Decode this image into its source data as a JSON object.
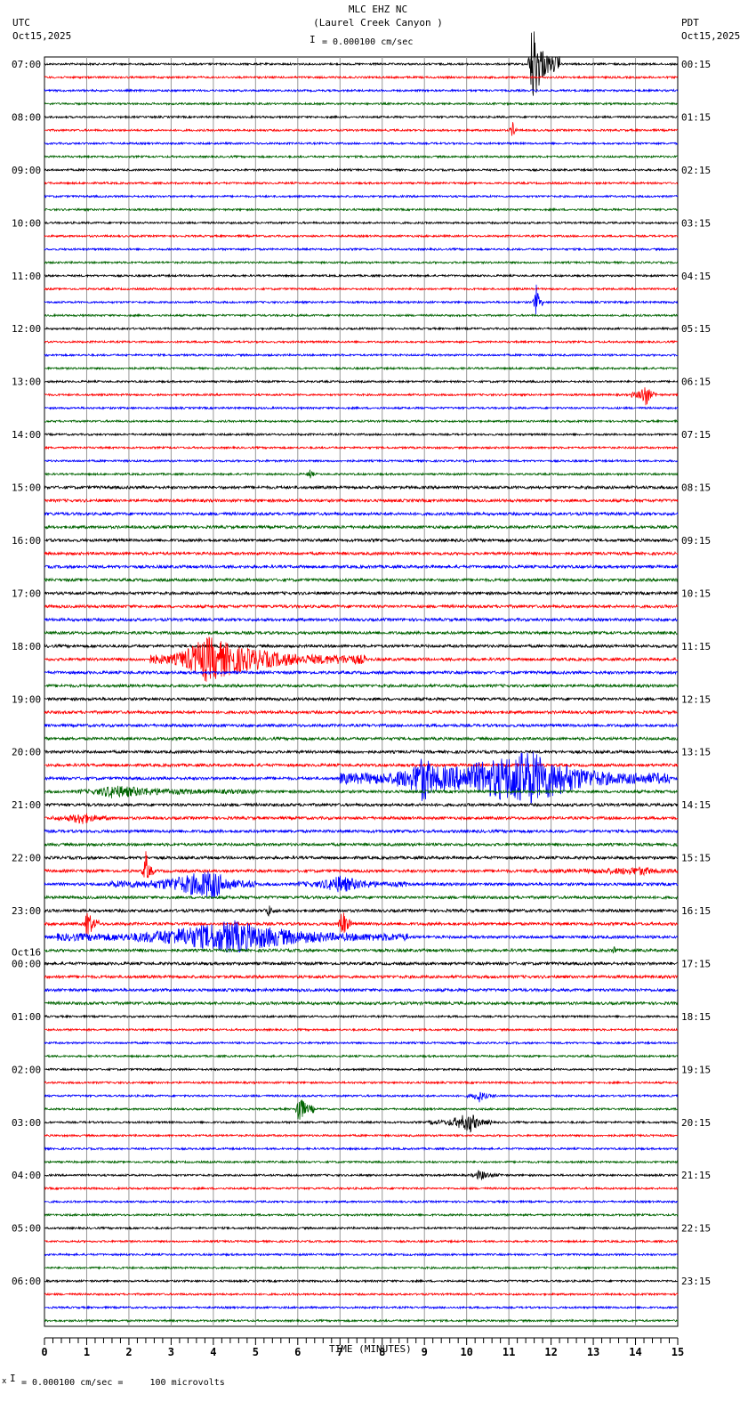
{
  "header": {
    "title": "MLC EHZ NC",
    "subtitle": "(Laurel Creek Canyon )",
    "left_tz": "UTC",
    "left_date": "Oct15,2025",
    "right_tz": "PDT",
    "right_date": "Oct15,2025",
    "scale": "= 0.000100 cm/sec"
  },
  "footer": {
    "scale": "= 0.000100 cm/sec =     100 microvolts",
    "mark": "x"
  },
  "chart_data": {
    "type": "line",
    "title": "MLC EHZ NC (Laurel Creek Canyon )",
    "xlabel": "TIME (MINUTES)",
    "xlim": [
      0,
      15
    ],
    "x_ticks": [
      "0",
      "1",
      "2",
      "3",
      "4",
      "5",
      "6",
      "7",
      "8",
      "9",
      "10",
      "11",
      "12",
      "13",
      "14",
      "15"
    ],
    "traces_per_hour": 4,
    "trace_colors": [
      "#000000",
      "#ff0000",
      "#0000ff",
      "#006400"
    ],
    "left_labels": [
      "07:00",
      "08:00",
      "09:00",
      "10:00",
      "11:00",
      "12:00",
      "13:00",
      "14:00",
      "15:00",
      "16:00",
      "17:00",
      "18:00",
      "19:00",
      "20:00",
      "21:00",
      "22:00",
      "23:00",
      "Oct16\n00:00",
      "01:00",
      "02:00",
      "03:00",
      "04:00",
      "05:00",
      "06:00"
    ],
    "right_labels": [
      "00:15",
      "01:15",
      "02:15",
      "03:15",
      "04:15",
      "05:15",
      "06:15",
      "07:15",
      "08:15",
      "09:15",
      "10:15",
      "11:15",
      "12:15",
      "13:15",
      "14:15",
      "15:15",
      "16:15",
      "17:15",
      "18:15",
      "19:15",
      "20:15",
      "21:15",
      "22:15",
      "23:15"
    ],
    "events": [
      {
        "trace": 0,
        "start": 11.45,
        "end": 12.2,
        "peak": 11.55,
        "amp": 6
      },
      {
        "trace": 5,
        "start": 11.0,
        "end": 11.2,
        "peak": 11.1,
        "amp": 1.2
      },
      {
        "trace": 18,
        "start": 11.55,
        "end": 11.8,
        "peak": 11.65,
        "amp": 2.2
      },
      {
        "trace": 25,
        "start": 13.9,
        "end": 14.5,
        "peak": 14.25,
        "amp": 1.5
      },
      {
        "trace": 31,
        "start": 6.2,
        "end": 6.4,
        "peak": 6.3,
        "amp": 0.8
      },
      {
        "trace": 45,
        "start": 2.5,
        "end": 7.6,
        "peak": 3.85,
        "amp": 2.8
      },
      {
        "trace": 54,
        "start": 7.0,
        "end": 14.8,
        "peak": 11.5,
        "amp": 3.5
      },
      {
        "trace": 54,
        "start": 8.3,
        "end": 9.5,
        "peak": 9.0,
        "amp": 2.5
      },
      {
        "trace": 55,
        "start": 0.8,
        "end": 5.0,
        "peak": 1.6,
        "amp": 0.7
      },
      {
        "trace": 57,
        "start": 0.2,
        "end": 1.6,
        "peak": 0.9,
        "amp": 0.7
      },
      {
        "trace": 61,
        "start": 2.3,
        "end": 2.6,
        "peak": 2.4,
        "amp": 2.5
      },
      {
        "trace": 61,
        "start": 11.5,
        "end": 15,
        "peak": 14.2,
        "amp": 0.4
      },
      {
        "trace": 62,
        "start": 1.5,
        "end": 5.0,
        "peak": 4.0,
        "amp": 1.8
      },
      {
        "trace": 62,
        "start": 6.0,
        "end": 8.6,
        "peak": 7.0,
        "amp": 1.0
      },
      {
        "trace": 64,
        "start": 5.2,
        "end": 5.5,
        "peak": 5.3,
        "amp": 0.8
      },
      {
        "trace": 65,
        "start": 0.95,
        "end": 1.3,
        "peak": 1.0,
        "amp": 2.5
      },
      {
        "trace": 65,
        "start": 6.95,
        "end": 7.3,
        "peak": 7.05,
        "amp": 2.5
      },
      {
        "trace": 66,
        "start": 0.3,
        "end": 8.6,
        "peak": 4.5,
        "amp": 2.0
      },
      {
        "trace": 67,
        "start": 13.4,
        "end": 13.6,
        "peak": 13.5,
        "amp": 0.5
      },
      {
        "trace": 78,
        "start": 10.0,
        "end": 10.7,
        "peak": 10.3,
        "amp": 0.7
      },
      {
        "trace": 79,
        "start": 5.95,
        "end": 6.4,
        "peak": 6.0,
        "amp": 2.5
      },
      {
        "trace": 80,
        "start": 9.1,
        "end": 10.6,
        "peak": 10.1,
        "amp": 1.2
      },
      {
        "trace": 84,
        "start": 10.1,
        "end": 10.9,
        "peak": 10.3,
        "amp": 0.6
      }
    ]
  }
}
